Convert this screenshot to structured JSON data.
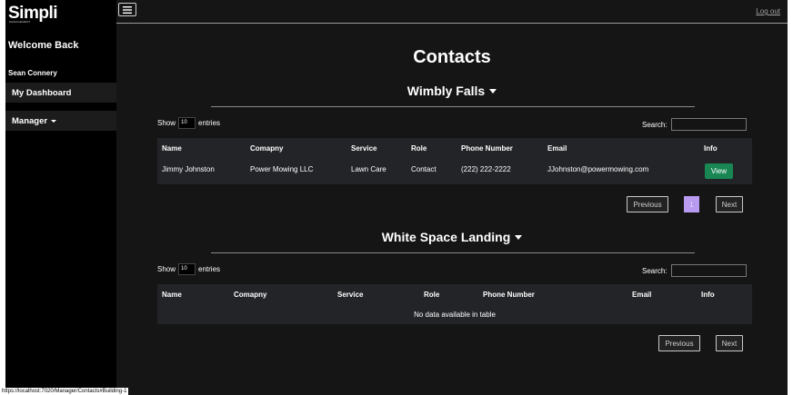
{
  "sidebar": {
    "logo": "Simpli",
    "logo_sub": "MANAGEMENT",
    "welcome": "Welcome Back",
    "user_name": "Sean Connery",
    "nav": {
      "dashboard": "My Dashboard",
      "manager": "Manager"
    }
  },
  "topbar": {
    "logout": "Log out"
  },
  "page": {
    "title": "Contacts"
  },
  "sections": [
    {
      "title": "Wimbly Falls",
      "show_prefix": "Show",
      "entries_value": "10",
      "show_suffix": "entries",
      "search_label": "Search:",
      "headers": [
        "Name",
        "Comapny",
        "Service",
        "Role",
        "Phone Number",
        "Email",
        "Info"
      ],
      "rows": [
        {
          "name": "Jimmy Johnston",
          "company": "Power Mowing LLC",
          "service": "Lawn Care",
          "role": "Contact",
          "phone": "(222) 222-2222",
          "email": "JJohnston@powermowing.com",
          "info_button": "View"
        }
      ],
      "pagination": {
        "previous": "Previous",
        "page": "1",
        "next": "Next"
      }
    },
    {
      "title": "White Space Landing",
      "show_prefix": "Show",
      "entries_value": "10",
      "show_suffix": "entries",
      "search_label": "Search:",
      "headers": [
        "Name",
        "Comapny",
        "Service",
        "Role",
        "Phone Number",
        "Email",
        "Info"
      ],
      "empty_message": "No data available in table",
      "pagination": {
        "previous": "Previous",
        "next": "Next"
      }
    }
  ],
  "status_bar": {
    "url": "https://localhost:7020/Manager/Contacts#Building-1"
  },
  "colors": {
    "background": "#151515",
    "sidebar": "#000000",
    "table": "#222427",
    "view_button": "#198754",
    "active_page": "#b89bf0"
  }
}
